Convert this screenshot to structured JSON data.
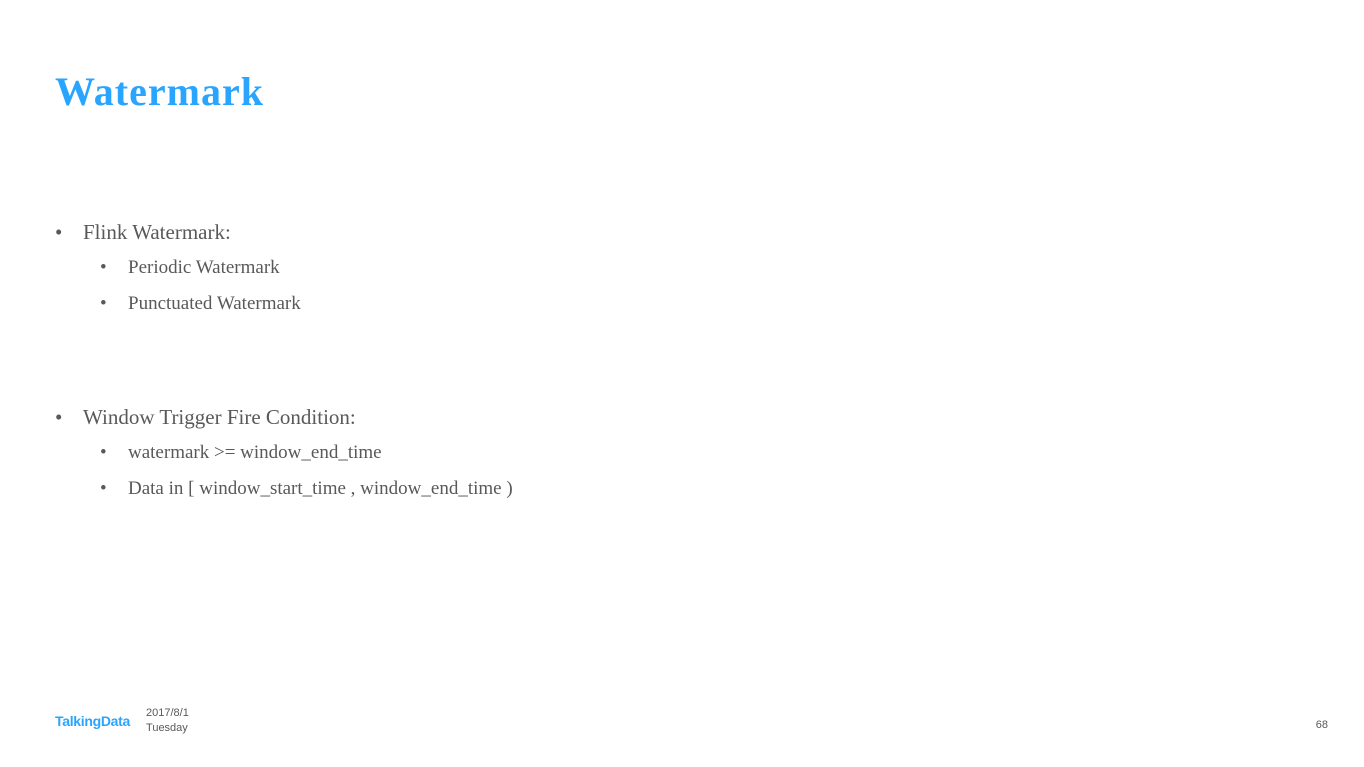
{
  "title": "Watermark",
  "section1": {
    "heading": "Flink Watermark:",
    "items": [
      "Periodic Watermark",
      "Punctuated Watermark"
    ]
  },
  "section2": {
    "heading": "Window Trigger Fire Condition:",
    "items": [
      "watermark >= window_end_time",
      "Data in [ window_start_time , window_end_time )"
    ]
  },
  "footer": {
    "logo": "TalkingData",
    "date": "2017/8/1",
    "day": "Tuesday"
  },
  "pageNumber": "68"
}
